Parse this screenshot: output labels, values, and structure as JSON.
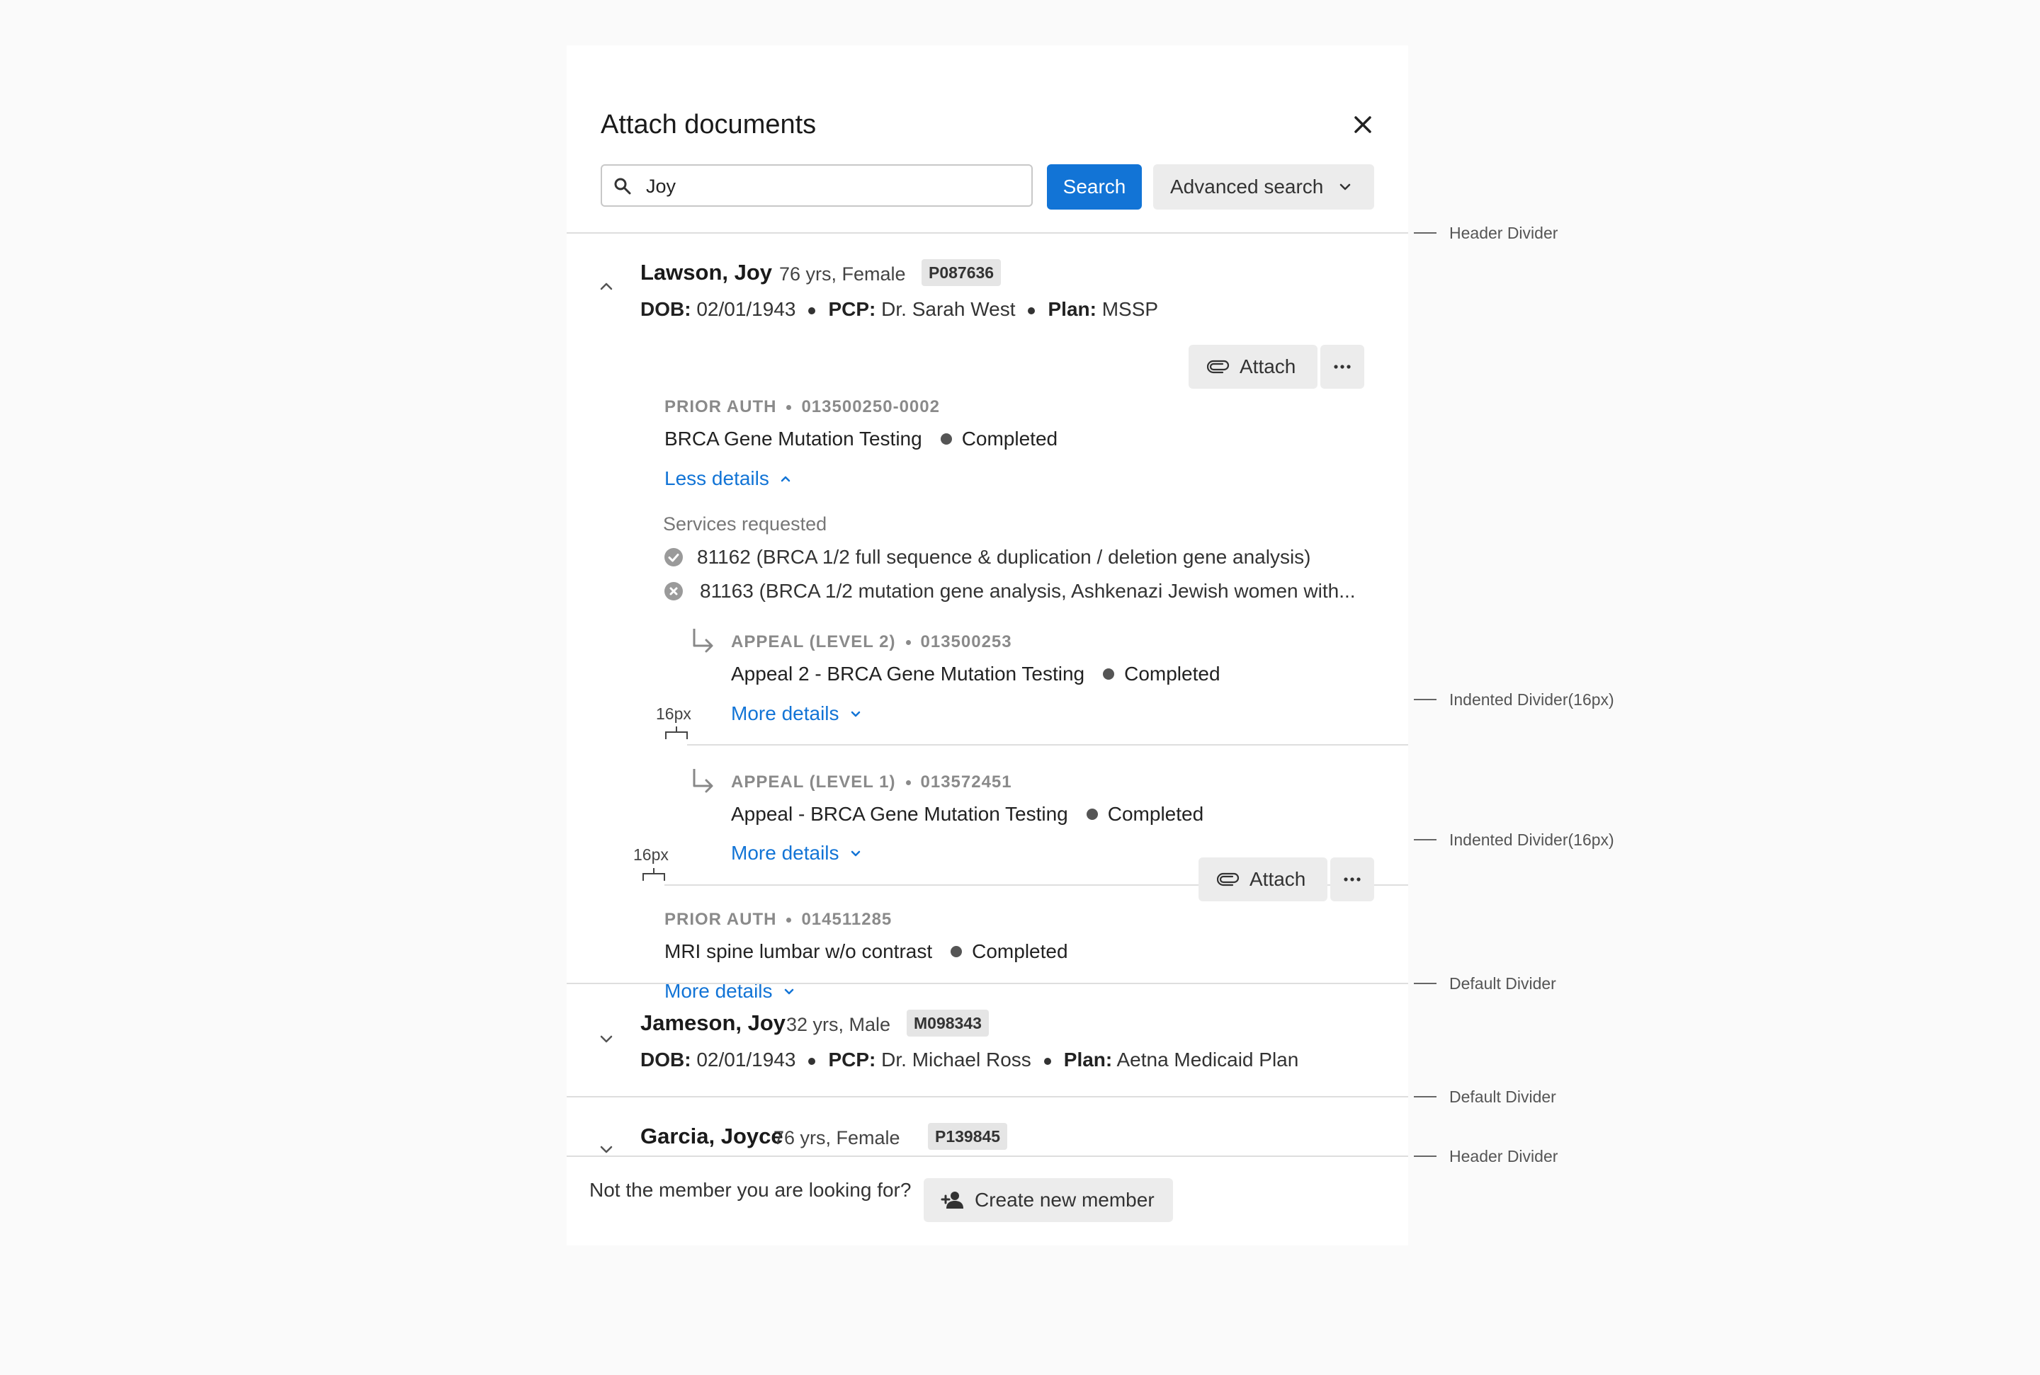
{
  "modal": {
    "title": "Attach documents",
    "search": {
      "value": "Joy",
      "button_label": "Search",
      "advanced_label": "Advanced search"
    }
  },
  "labels": {
    "dob": "DOB:",
    "pcp": "PCP:",
    "plan": "Plan:",
    "attach": "Attach"
  },
  "members": [
    {
      "name": "Lawson, Joy",
      "age_sex": "76 yrs, Female",
      "id": "P087636",
      "dob": "02/01/1943",
      "pcp": "Dr. Sarah West",
      "plan": "MSSP",
      "expanded": true,
      "items": [
        {
          "type": "PRIOR AUTH",
          "number": "013500250-0002",
          "title": "BRCA Gene Mutation Testing",
          "status": "Completed",
          "toggle": "Less details",
          "services_heading": "Services requested",
          "services": [
            {
              "text": "81162 (BRCA 1/2 full sequence & duplication / deletion gene analysis)",
              "state": "approved",
              "icon": "check-circle-icon"
            },
            {
              "text": "81163 (BRCA 1/2 mutation gene analysis, Ashkenazi Jewish women with...",
              "state": "denied",
              "icon": "x-circle-icon"
            }
          ],
          "appeals": [
            {
              "type": "APPEAL (LEVEL 2)",
              "number": "013500253",
              "title": "Appeal 2 - BRCA Gene Mutation Testing",
              "status": "Completed",
              "toggle": "More details"
            },
            {
              "type": "APPEAL (LEVEL 1)",
              "number": "013572451",
              "title": "Appeal - BRCA Gene Mutation Testing",
              "status": "Completed",
              "toggle": "More details"
            }
          ]
        },
        {
          "type": "PRIOR AUTH",
          "number": "014511285",
          "title": "MRI spine lumbar w/o contrast",
          "status": "Completed",
          "toggle": "More details"
        }
      ]
    },
    {
      "name": "Jameson, Joy",
      "age_sex": "32 yrs, Male",
      "id": "M098343",
      "dob": "02/01/1943",
      "pcp": "Dr. Michael Ross",
      "plan": "Aetna Medicaid Plan",
      "expanded": false
    },
    {
      "name": "Garcia, Joyce",
      "age_sex": "76 yrs, Female",
      "id": "P139845",
      "expanded": false
    }
  ],
  "footer": {
    "text": "Not the member you are looking for?",
    "create_label": "Create new member"
  },
  "annotations": {
    "header_divider": "Header Divider",
    "indented_divider": "Indented Divider(16px)",
    "default_divider": "Default Divider",
    "spacing_label": "16px"
  },
  "colors": {
    "primary": "#1274d6",
    "button_gray": "#ececec",
    "divider": "#dedede",
    "status_dot": "#555555"
  }
}
